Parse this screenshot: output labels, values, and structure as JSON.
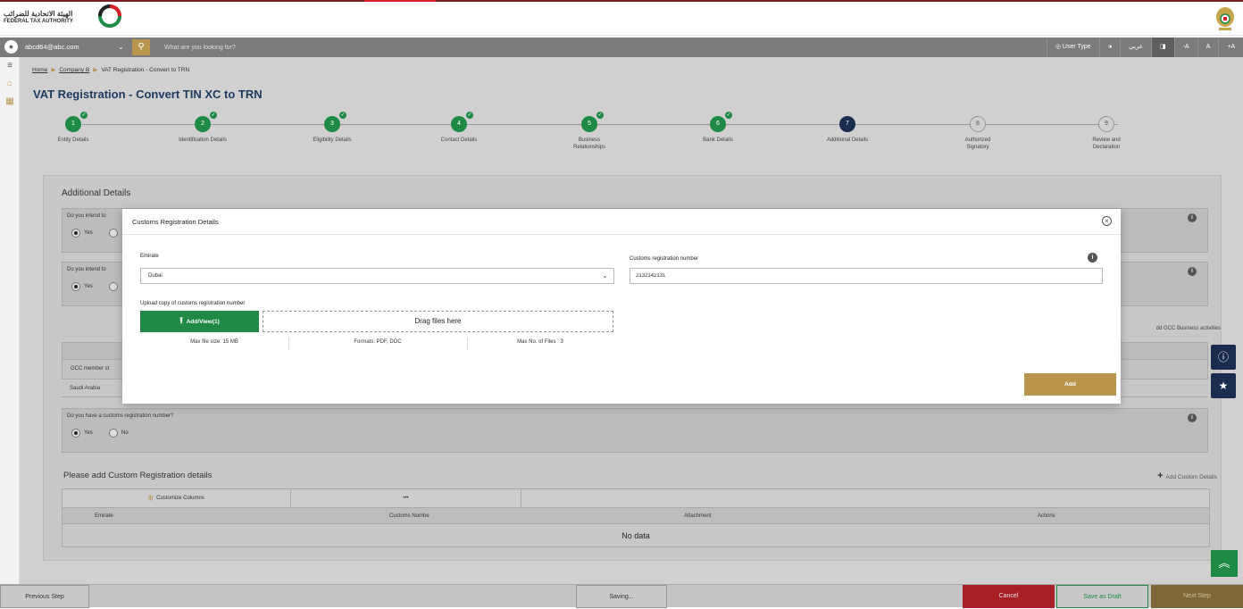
{
  "header": {
    "logo_arabic": "الهيئة الاتحادية للضرائب",
    "logo_english": "FEDERAL TAX AUTHORITY"
  },
  "topbar": {
    "user_email": "abcd64@abc.com",
    "search_placeholder": "What are you looking for?",
    "user_type": "User Type",
    "arabic_label": "عربي",
    "font_minus": "-A",
    "font_normal": "A",
    "font_plus": "+A"
  },
  "breadcrumb": {
    "home": "Home",
    "company": "Company B",
    "current": "VAT Registration - Convert to TRN"
  },
  "page_title": "VAT Registration - Convert TIN XC to TRN",
  "steps": [
    {
      "num": "1",
      "label": "Entity Details",
      "state": "done"
    },
    {
      "num": "2",
      "label": "Identification Details",
      "state": "done"
    },
    {
      "num": "3",
      "label": "Eligibility Details",
      "state": "done"
    },
    {
      "num": "4",
      "label": "Contact Details",
      "state": "done"
    },
    {
      "num": "5",
      "label": "Business Relationships",
      "state": "done"
    },
    {
      "num": "6",
      "label": "Bank Details",
      "state": "done"
    },
    {
      "num": "7",
      "label": "Additional Details",
      "state": "current"
    },
    {
      "num": "8",
      "label": "Authorized Signatory",
      "state": "todo"
    },
    {
      "num": "9",
      "label": "Review and Declaration",
      "state": "todo"
    }
  ],
  "additional": {
    "title": "Additional Details",
    "q1": "Do you intend to",
    "q2": "Do you intend to",
    "yes": "Yes",
    "no": "No",
    "gcc_side_text": "dd GCC Business activities",
    "gcc_col_header": "GCC member st",
    "gcc_row_value": "Saudi Arabia",
    "customs_question": "Do you have a customs registration number?"
  },
  "custom_section": {
    "title": "Please add Custom Registration details",
    "add_link": "Add Custom Details",
    "customize_columns": "Customize Columns",
    "dots": "•••",
    "columns": [
      "Emirate",
      "Customs Numbe",
      "Attachment",
      "Actions"
    ],
    "empty_text": "No data"
  },
  "modal": {
    "title": "Customs Registration Details",
    "emirate_label": "Emirate",
    "emirate_value": "Dubai",
    "customs_label": "Customs registration number",
    "customs_value": "2132142131",
    "upload_label": "Upload copy of customs registration number",
    "upload_button": "Add/View(1)",
    "drop_text": "Drag files here",
    "max_size": "Max file size: 15 MB",
    "formats": "Formats: PDF, DOC",
    "max_files": "Max No. of Files : 3",
    "add_button": "Add"
  },
  "footer": {
    "previous": "Previous Step",
    "saving": "Saving...",
    "cancel": "Cancel",
    "save_draft": "Save as Draft",
    "next": "Next Step"
  },
  "colors": {
    "gold": "#b8944d",
    "green": "#1e8a45",
    "navy": "#1b2d4f",
    "red": "#a81f25"
  }
}
